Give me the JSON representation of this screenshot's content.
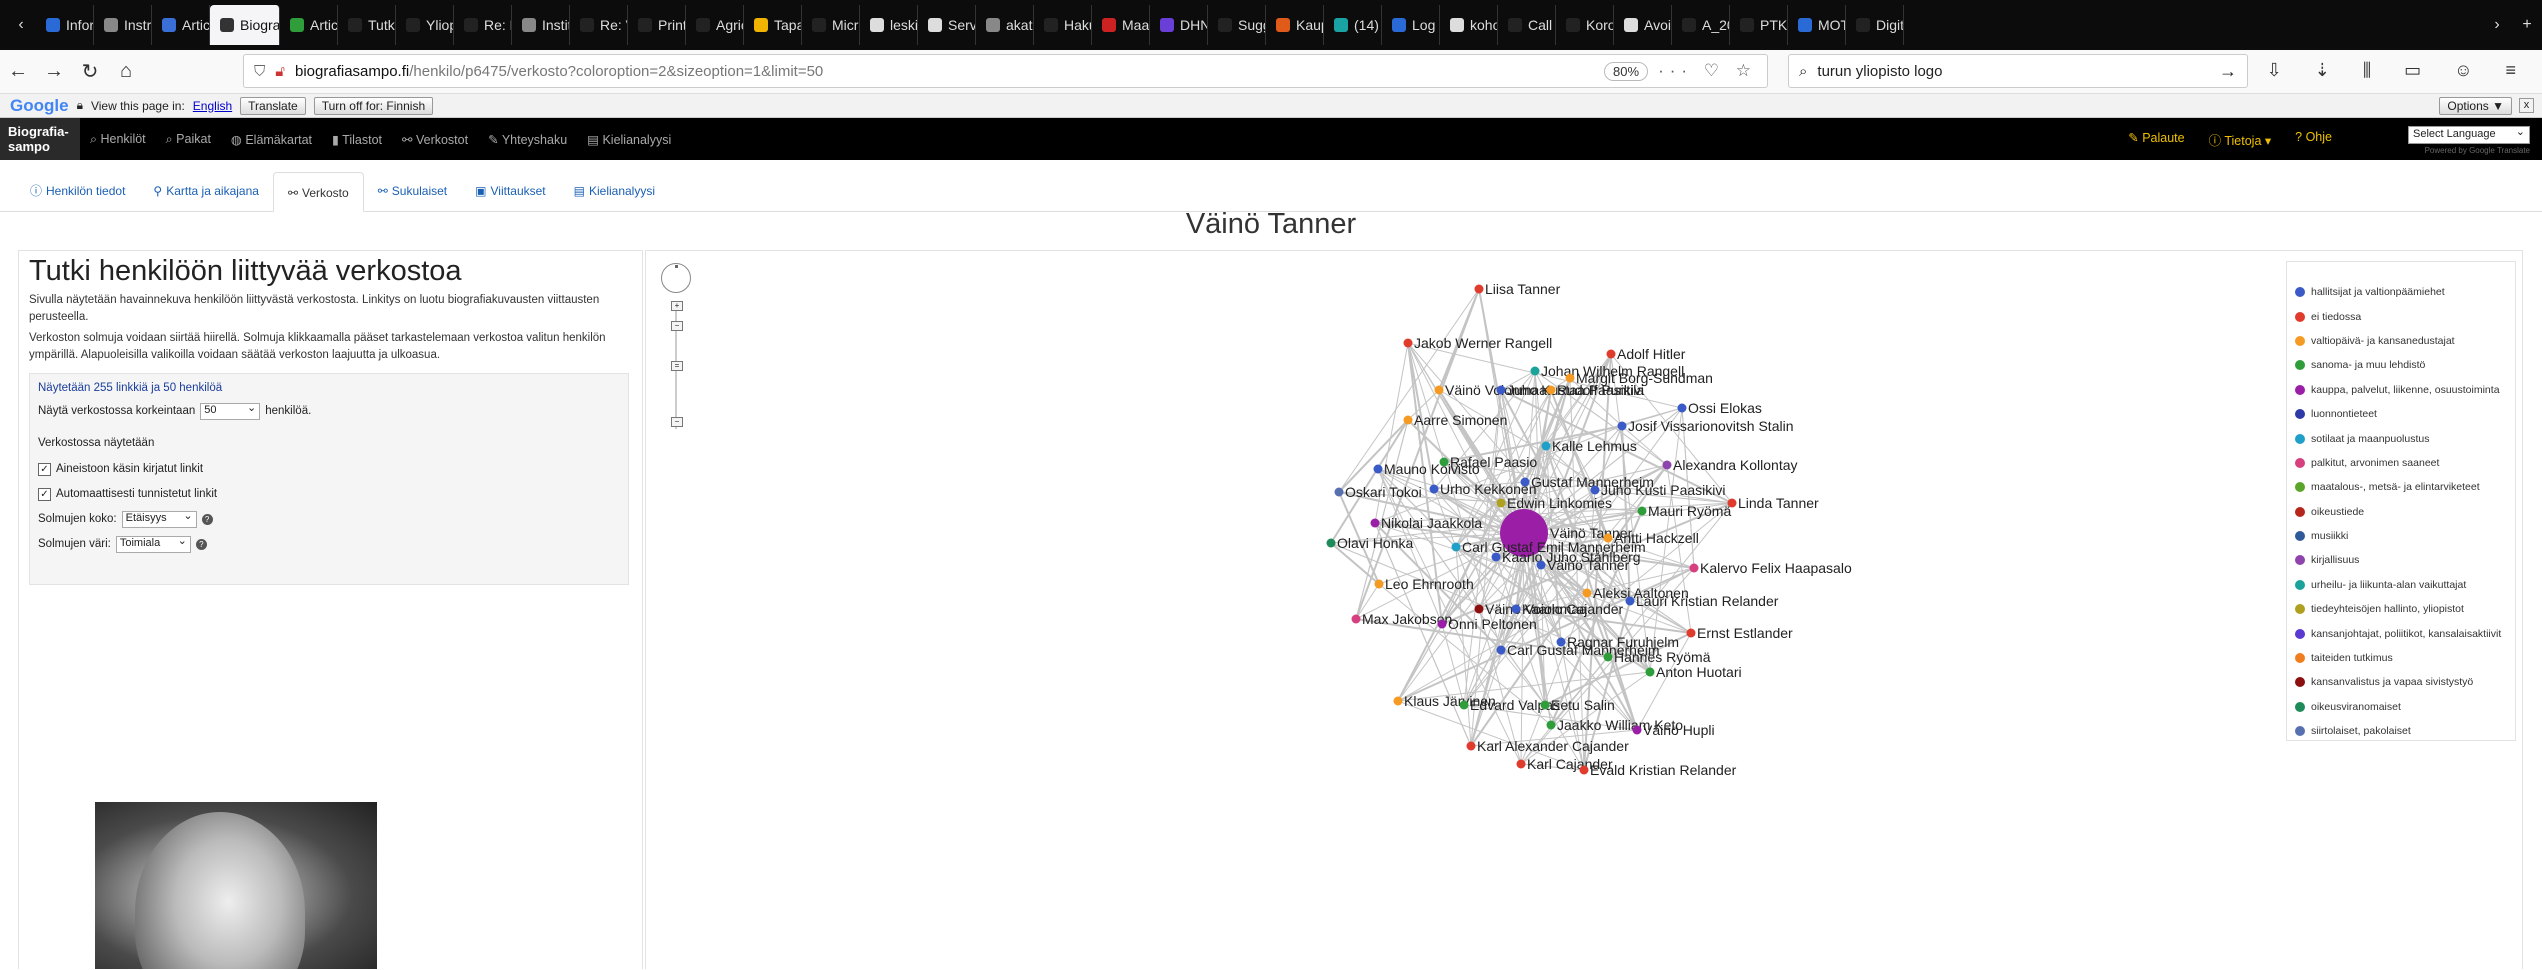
{
  "browser": {
    "tabs": [
      {
        "label": "Inform",
        "color": "#2a6ad6"
      },
      {
        "label": "Instru",
        "color": "#888888"
      },
      {
        "label": "Article",
        "color": "#3b6fd8"
      },
      {
        "label": "Biograf",
        "color": "#333333",
        "active": true
      },
      {
        "label": "Article",
        "color": "#2e9d3a"
      },
      {
        "label": "Tutkin",
        "color": "#222222"
      },
      {
        "label": "Yliopis",
        "color": "#222222"
      },
      {
        "label": "Re: Kaupu",
        "color": "#222222"
      },
      {
        "label": "Institu",
        "color": "#888888"
      },
      {
        "label": "Re: VS: Ka",
        "color": "#222222"
      },
      {
        "label": "Print confi",
        "color": "#222222"
      },
      {
        "label": "Agricu",
        "color": "#222222"
      },
      {
        "label": "Tapaan",
        "color": "#f0b400"
      },
      {
        "label": "Microsoft",
        "color": "#222222"
      },
      {
        "label": "leskinen",
        "color": "#dddddd"
      },
      {
        "label": "Server",
        "color": "#dddddd"
      },
      {
        "label": "akatem",
        "color": "#888888"
      },
      {
        "label": "Haku :: Hel",
        "color": "#222222"
      },
      {
        "label": "Maas",
        "color": "#cc2222"
      },
      {
        "label": "DHNL",
        "color": "#6a3fd8"
      },
      {
        "label": "Sugge",
        "color": "#222222"
      },
      {
        "label": "Kaupu",
        "color": "#e05a1a"
      },
      {
        "label": "(14) To",
        "color": "#1aa3a3"
      },
      {
        "label": "Log In",
        "color": "#2a6ad6"
      },
      {
        "label": "kohok",
        "color": "#dddddd"
      },
      {
        "label": "Call For Pr",
        "color": "#222222"
      },
      {
        "label": "Korona",
        "color": "#222222"
      },
      {
        "label": "Avoin",
        "color": "#dddddd"
      },
      {
        "label": "A_2000_S",
        "color": "#222222"
      },
      {
        "label": "PTK_2000",
        "color": "#222222"
      },
      {
        "label": "MOT |",
        "color": "#2a6ad6"
      },
      {
        "label": "Digitoidut",
        "color": "#222222"
      }
    ],
    "url_host": "biografiasampo.fi",
    "url_path": "/henkilo/p6475/verkosto?coloroption=2&sizeoption=1&limit=50",
    "zoom": "80%",
    "search_value": "turun yliopisto logo"
  },
  "google_translate": {
    "logo": "Google",
    "view_text": "View this page in:",
    "language": "English",
    "translate_btn": "Translate",
    "turn_off_btn": "Turn off for: Finnish",
    "options_btn": "Options ▼",
    "close": "x"
  },
  "app_nav": {
    "brand_line1": "Biografia-",
    "brand_line2": "sampo",
    "items": [
      {
        "icon": "⌕",
        "label": "Henkilöt"
      },
      {
        "icon": "⌕",
        "label": "Paikat"
      },
      {
        "icon": "◍",
        "label": "Elämäkartat"
      },
      {
        "icon": "▮",
        "label": "Tilastot"
      },
      {
        "icon": "⚯",
        "label": "Verkostot"
      },
      {
        "icon": "✎",
        "label": "Yhteyshaku"
      },
      {
        "icon": "▤",
        "label": "Kielianalyysi"
      }
    ],
    "right_items": [
      "✎ Palaute",
      "ⓘ Tietoja ▾",
      "? Ohje"
    ],
    "lang_select": "Select Language",
    "powered": "Powered by Google Translate"
  },
  "page_tabs": [
    {
      "icon": "ⓘ",
      "label": "Henkilön tiedot"
    },
    {
      "icon": "⚲",
      "label": "Kartta ja aikajana"
    },
    {
      "icon": "⚯",
      "label": "Verkosto",
      "active": true
    },
    {
      "icon": "⚯",
      "label": "Sukulaiset"
    },
    {
      "icon": "▣",
      "label": "Viittaukset"
    },
    {
      "icon": "▤",
      "label": "Kielianalyysi"
    }
  ],
  "person_name": "Väinö Tanner",
  "left_panel": {
    "heading": "Tutki henkilöön liittyvää verkostoa",
    "p1": "Sivulla näytetään havainnekuva henkilöön liittyvästä verkostosta. Linkitys on luotu biografiakuvausten viittausten perusteella.",
    "p2": "Verkoston solmuja voidaan siirtää hiirellä. Solmuja klikkaamalla pääset tarkastelemaan verkostoa valitun henkilön ympärillä. Alapuoleisilla valikoilla voidaan säätää verkoston laajuutta ja ulkoasua.",
    "info": "Näytetään 255 linkkiä ja 50 henkilöä",
    "limit_prefix": "Näytä verkostossa korkeintaan",
    "limit_value": "50",
    "limit_suffix": "henkilöä.",
    "shown_header": "Verkostossa näytetään",
    "cb1": "Aineistoon käsin kirjatut linkit",
    "cb2": "Automaattisesti tunnistetut linkit",
    "size_label": "Solmujen koko:",
    "size_value": "Etäisyys",
    "color_label": "Solmujen väri:",
    "color_value": "Toimiala",
    "help": "?"
  },
  "legend": [
    {
      "label": "hallitsijat ja valtionpäämiehet",
      "color": "#3a5bc7"
    },
    {
      "label": "ei tiedossa",
      "color": "#e03c2d"
    },
    {
      "label": "valtiopäivä- ja kansanedustajat",
      "color": "#f59a22"
    },
    {
      "label": "sanoma- ja muu lehdistö",
      "color": "#2e9d3a"
    },
    {
      "label": "kauppa, palvelut, liikenne, osuustoiminta",
      "color": "#9b1fa6"
    },
    {
      "label": "luonnontieteet",
      "color": "#2d3aa8"
    },
    {
      "label": "sotilaat ja maanpuolustus",
      "color": "#1fa0c8"
    },
    {
      "label": "palkitut, arvonimen saaneet",
      "color": "#d6407e"
    },
    {
      "label": "maatalous-, metsä- ja elintarviketeet",
      "color": "#5aa52a"
    },
    {
      "label": "oikeustiede",
      "color": "#b5261d"
    },
    {
      "label": "musiikki",
      "color": "#2f5a9a"
    },
    {
      "label": "kirjallisuus",
      "color": "#8e44ad"
    },
    {
      "label": "urheilu- ja liikunta-alan vaikuttajat",
      "color": "#1aa39a"
    },
    {
      "label": "tiedeyhteisöjen hallinto, yliopistot",
      "color": "#b0a020"
    },
    {
      "label": "kansanjohtajat, poliitikot, kansalaisaktiivit",
      "color": "#5a3ad1"
    },
    {
      "label": "taiteiden tutkimus",
      "color": "#f07e1f"
    },
    {
      "label": "kansanvalistus ja vapaa sivistystyö",
      "color": "#8c1010"
    },
    {
      "label": "oikeusviranomaiset",
      "color": "#1f8a5a"
    },
    {
      "label": "siirtolaiset, pakolaiset",
      "color": "#5670b0"
    }
  ],
  "graph": {
    "center": "Väinö Tanner",
    "nodes": [
      {
        "label": "Liisa Tanner",
        "color": "#e03c2d"
      },
      {
        "label": "Jakob Werner Rangell",
        "color": "#e03c2d"
      },
      {
        "label": "Adolf Hitler",
        "color": "#e03c2d"
      },
      {
        "label": "Johan Wilhelm Rangell",
        "color": "#1aa39a"
      },
      {
        "label": "Margit Borg-Sundman",
        "color": "#f59a22"
      },
      {
        "label": "Väinö Voionmaa",
        "color": "#f59a22"
      },
      {
        "label": "Juho Kustaa Paasikivi",
        "color": "#3a5bc7"
      },
      {
        "label": "Rudolf Puntila",
        "color": "#f59a22"
      },
      {
        "label": "Ossi Elokas",
        "color": "#3a5bc7"
      },
      {
        "label": "Josif Vissarionovitsh Stalin",
        "color": "#3a5bc7"
      },
      {
        "label": "Aarre Simonen",
        "color": "#f59a22"
      },
      {
        "label": "Kalle Lehmus",
        "color": "#1fa0c8"
      },
      {
        "label": "Rafael Paasio",
        "color": "#2e9d3a"
      },
      {
        "label": "Mauno Koivisto",
        "color": "#3a5bc7"
      },
      {
        "label": "Alexandra Kollontay",
        "color": "#8e44ad"
      },
      {
        "label": "Oskari Tokoi",
        "color": "#5670b0"
      },
      {
        "label": "Urho Kekkonen",
        "color": "#3a5bc7"
      },
      {
        "label": "Gustaf Mannerheim",
        "color": "#3a5bc7"
      },
      {
        "label": "Juho Kusti Paasikivi",
        "color": "#3a5bc7"
      },
      {
        "label": "Edwin Linkomies",
        "color": "#b0a020"
      },
      {
        "label": "Mauri Ryömä",
        "color": "#2e9d3a"
      },
      {
        "label": "Linda Tanner",
        "color": "#e03c2d"
      },
      {
        "label": "Nikolai Jaakkola",
        "color": "#9b1fa6"
      },
      {
        "label": "Väinö Tanner",
        "color": "#9b1fa6",
        "center": true
      },
      {
        "label": "Antti Hackzell",
        "color": "#f59a22"
      },
      {
        "label": "Olavi Honka",
        "color": "#1f8a5a"
      },
      {
        "label": "Carl Gustaf Emil Mannerheim",
        "color": "#1fa0c8"
      },
      {
        "label": "Kaarlo Juho Ståhlberg",
        "color": "#3a5bc7"
      },
      {
        "label": "Väinö Tanner",
        "color": "#3a5bc7"
      },
      {
        "label": "Kalervo Felix Haapasalo",
        "color": "#d6407e"
      },
      {
        "label": "Leo Ehrnrooth",
        "color": "#f59a22"
      },
      {
        "label": "Aleksi Aaltonen",
        "color": "#f59a22"
      },
      {
        "label": "Lauri Kristian Relander",
        "color": "#3a5bc7"
      },
      {
        "label": "Väinö Voionmaa",
        "color": "#8c1010"
      },
      {
        "label": "Kaarlo Cajander",
        "color": "#3a5bc7"
      },
      {
        "label": "Max Jakobson",
        "color": "#d6407e"
      },
      {
        "label": "Onni Peltonen",
        "color": "#9b1fa6"
      },
      {
        "label": "Ernst Estlander",
        "color": "#e03c2d"
      },
      {
        "label": "Ragnar Furuhjelm",
        "color": "#3a5bc7"
      },
      {
        "label": "Carl Gustaf Mannerheim",
        "color": "#3a5bc7"
      },
      {
        "label": "Hannes Ryömä",
        "color": "#2e9d3a"
      },
      {
        "label": "Anton Huotari",
        "color": "#2e9d3a"
      },
      {
        "label": "Klaus Järvinen",
        "color": "#f59a22"
      },
      {
        "label": "Edvard Valpas",
        "color": "#2e9d3a"
      },
      {
        "label": "Eetu Salin",
        "color": "#2e9d3a"
      },
      {
        "label": "Jaakko William Keto",
        "color": "#2e9d3a"
      },
      {
        "label": "Väinö Hupli",
        "color": "#9b1fa6"
      },
      {
        "label": "Karl Alexander Cajander",
        "color": "#e03c2d"
      },
      {
        "label": "Karl Cajander",
        "color": "#e03c2d"
      },
      {
        "label": "Evald Kristian Relander",
        "color": "#e03c2d"
      }
    ]
  }
}
